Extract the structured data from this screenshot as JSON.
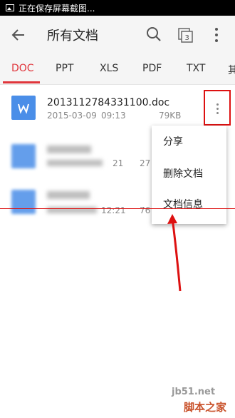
{
  "status_bar": {
    "text": "正在保存屏幕截图..."
  },
  "header": {
    "title": "所有文档"
  },
  "tabs": [
    {
      "label": "DOC"
    },
    {
      "label": "PPT"
    },
    {
      "label": "XLS"
    },
    {
      "label": "PDF"
    },
    {
      "label": "TXT"
    },
    {
      "label": "其"
    }
  ],
  "files": [
    {
      "name": "2013112784331100.doc",
      "date": "2015-03-09",
      "time": "09:13",
      "size": "79KB"
    },
    {
      "time": "21",
      "size": "27"
    },
    {
      "time": "12:21",
      "size": "76"
    }
  ],
  "menu": {
    "items": [
      {
        "label": "分享"
      },
      {
        "label": "删除文档"
      },
      {
        "label": "文档信息"
      }
    ]
  },
  "watermark": {
    "url": "jb51.net",
    "name": "脚本之家"
  },
  "colors": {
    "accent": "#e0353b",
    "file_icon": "#4a8ee8",
    "annotation": "#d11111"
  }
}
